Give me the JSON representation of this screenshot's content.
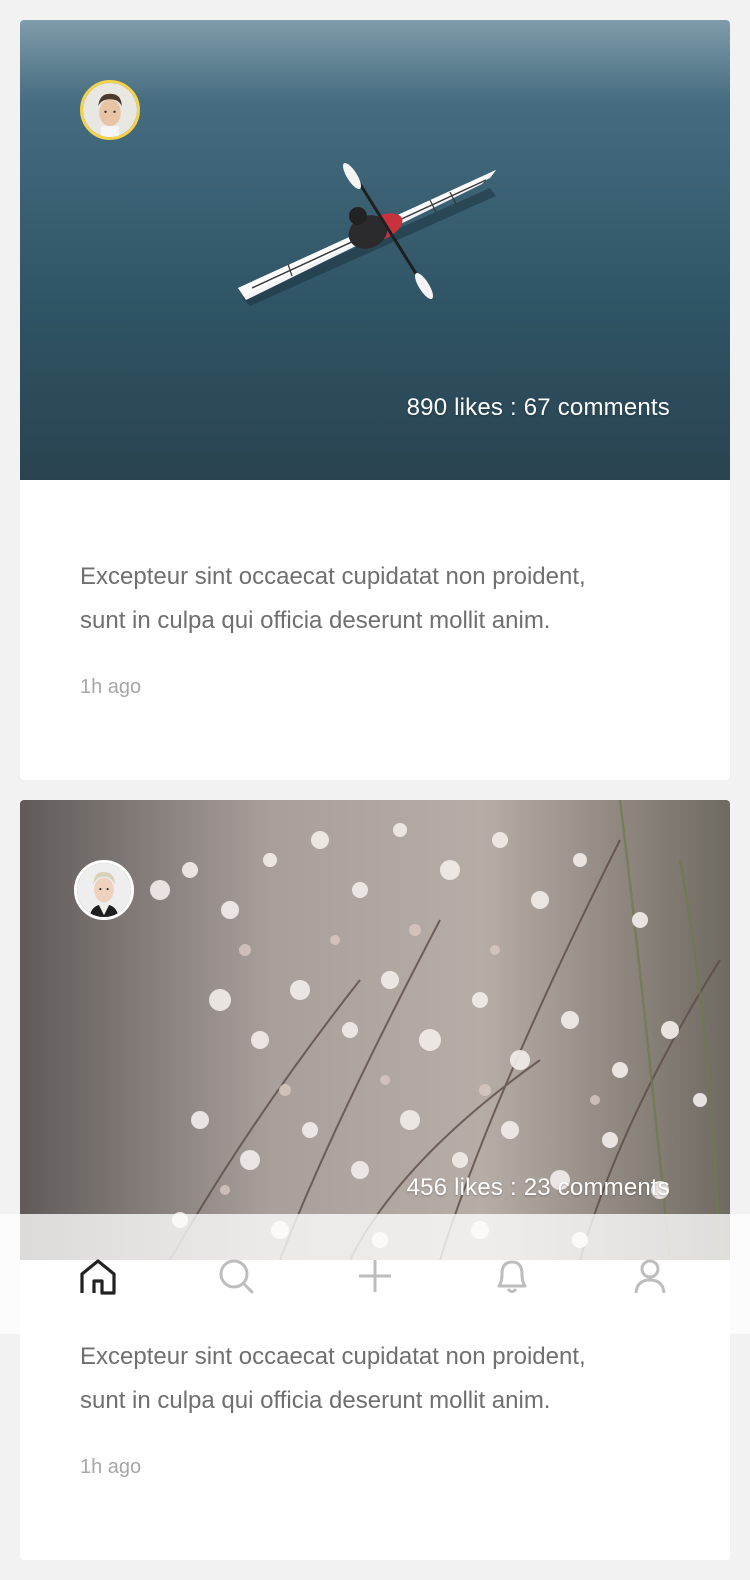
{
  "feed": {
    "posts": [
      {
        "author_avatar": "avatar-man-dark-hair",
        "photo_subject": "kayak-on-water",
        "stats": "890 likes : 67 comments",
        "caption_line1": "Excepteur sint occaecat cupidatat non proident,",
        "caption_line2": "sunt in culpa qui officia deserunt mollit anim.",
        "time": "1h ago"
      },
      {
        "author_avatar": "avatar-man-blond-hair",
        "photo_subject": "white-flowering-branches",
        "stats": "456 likes : 23 comments",
        "caption_line1": "Excepteur sint occaecat cupidatat non proident,",
        "caption_line2": "sunt in culpa qui officia deserunt mollit anim.",
        "time": "1h ago"
      }
    ]
  },
  "tabbar": {
    "items": [
      {
        "icon": "home-icon",
        "active": true
      },
      {
        "icon": "search-icon",
        "active": false
      },
      {
        "icon": "plus-icon",
        "active": false
      },
      {
        "icon": "bell-icon",
        "active": false
      },
      {
        "icon": "user-icon",
        "active": false
      }
    ],
    "colors": {
      "active": "#222222",
      "inactive": "#bdbdbd"
    }
  },
  "colors": {
    "background": "#f2f2f2",
    "card": "#ffffff",
    "caption": "#6f6f6f",
    "time": "#a6a6a6",
    "avatar_ring_1": "#f5d24a"
  }
}
